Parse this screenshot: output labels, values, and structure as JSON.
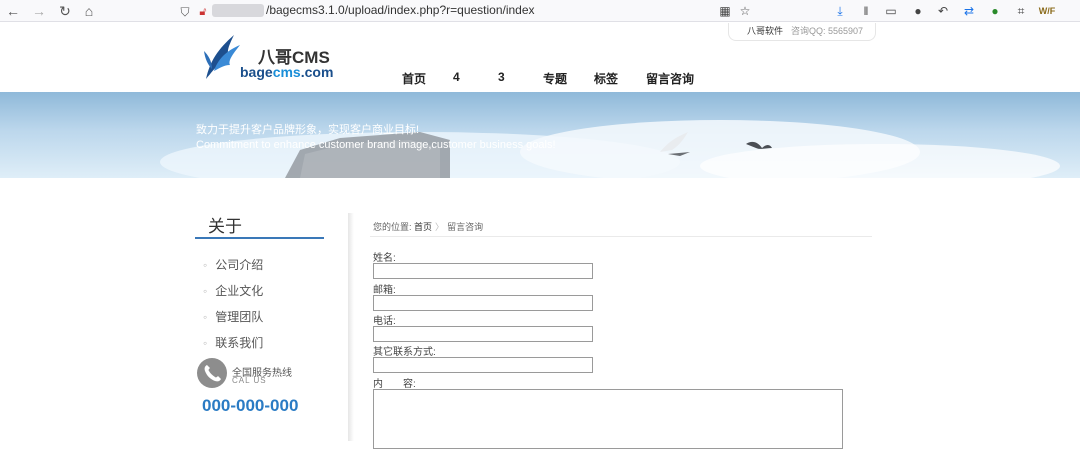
{
  "browser": {
    "url": "/bagecms3.1.0/upload/index.php?r=question/index"
  },
  "header": {
    "company": "八哥软件",
    "qq_label": "咨询QQ:  5565907",
    "logo_cn": "八哥CMS",
    "logo_en_prefix": "bage",
    "logo_en_cms": "cms",
    "logo_en_suffix": ".com"
  },
  "nav": {
    "items": [
      "首页",
      "4",
      "3",
      "专题",
      "标签",
      "留言咨询"
    ]
  },
  "banner": {
    "line_cn": "致力于提升客户品牌形象，实现客户商业目标!",
    "line_en": "Commitment to enhance customer brand image,customer business goals!"
  },
  "sidebar": {
    "title": "关于",
    "items": [
      "公司介绍",
      "企业文化",
      "管理团队",
      "联系我们"
    ],
    "hotline_label": "全国服务热线",
    "hotline_en": "CAL US",
    "hotline_number": "000-000-000"
  },
  "breadcrumb": {
    "prefix": "您的位置:",
    "home": "首页",
    "sep": "〉",
    "current": "留言咨询"
  },
  "form": {
    "name_label": "姓名:",
    "name_value": "",
    "email_label": "邮箱:",
    "email_value": "",
    "phone_label": "电话:",
    "phone_value": "",
    "other_label": "其它联系方式:",
    "other_value": "",
    "content_label": "内　　容:",
    "content_value": ""
  }
}
